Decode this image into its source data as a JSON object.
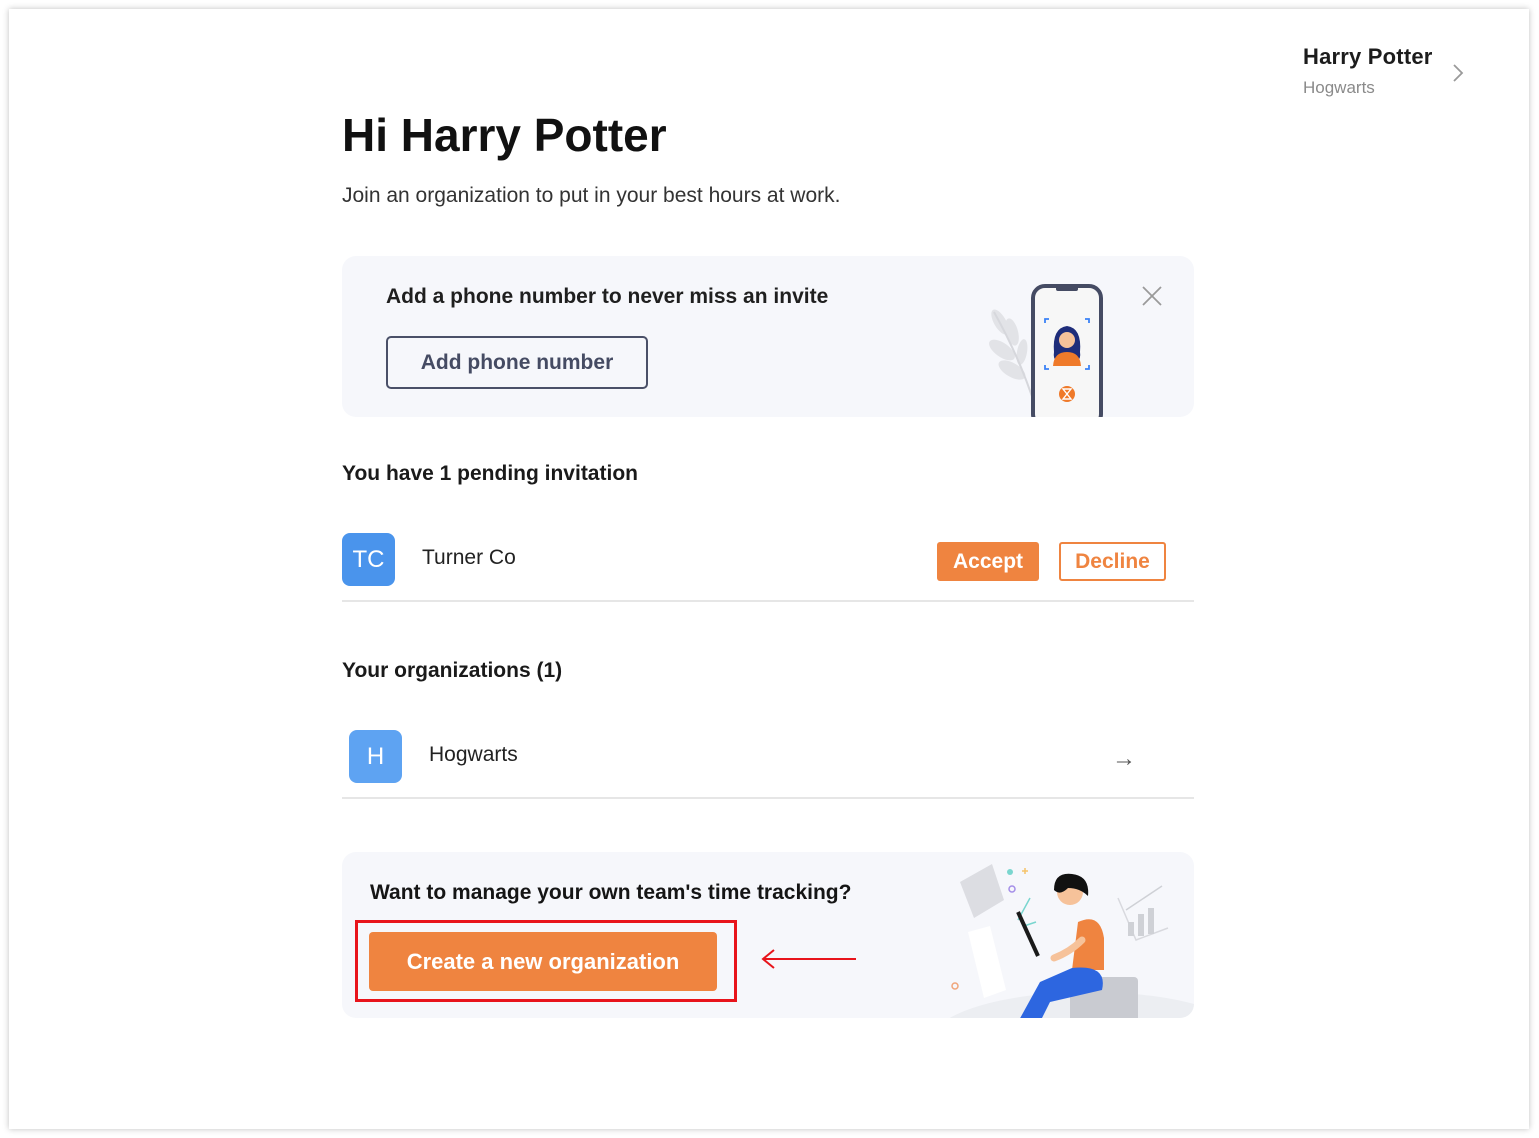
{
  "user": {
    "name": "Harry Potter",
    "organization": "Hogwarts",
    "chevron_icon": "chevron-right-icon"
  },
  "header": {
    "greeting": "Hi Harry Potter",
    "subtitle": "Join an organization to put in your best hours at work."
  },
  "phone_banner": {
    "title": "Add a phone number to never miss an invite",
    "button_label": "Add phone number",
    "close_icon": "close-icon",
    "illustration": "phone-verification-illustration"
  },
  "invitations": {
    "heading": "You have 1 pending invitation",
    "items": [
      {
        "initials": "TC",
        "name": "Turner Co",
        "avatar_color": "#4a94ec",
        "accept_label": "Accept",
        "decline_label": "Decline"
      }
    ]
  },
  "organizations": {
    "heading": "Your organizations (1)",
    "items": [
      {
        "initials": "H",
        "name": "Hogwarts",
        "avatar_color": "#5ea3f2",
        "arrow_icon": "arrow-right-icon"
      }
    ]
  },
  "create_banner": {
    "title": "Want to manage your own team's time tracking?",
    "button_label": "Create a new organization",
    "illustration": "person-with-laptop-illustration"
  },
  "colors": {
    "accent": "#ef8440",
    "annotation_red": "#e8141b",
    "card_bg": "#f6f7fb",
    "outline_button": "#4a5068"
  }
}
